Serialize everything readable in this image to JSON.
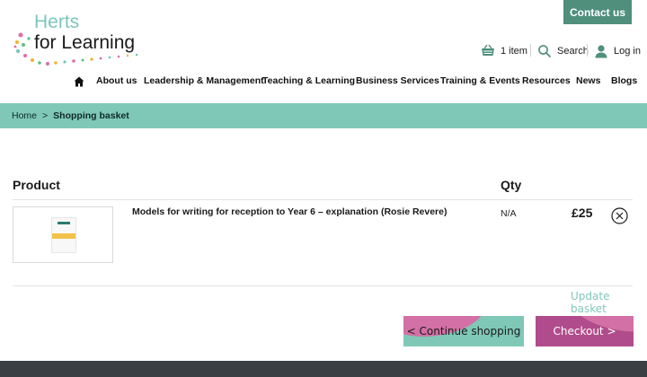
{
  "header": {
    "contact_label": "Contact us",
    "logo_line1": "Herts",
    "logo_line2": "for Learning",
    "basket_label": "1 item",
    "search_label": "Search",
    "login_label": "Log in"
  },
  "nav": {
    "items": [
      "About us",
      "Leadership & Management",
      "Teaching & Learning",
      "Business Services",
      "Training & Events",
      "Resources",
      "News",
      "Blogs"
    ]
  },
  "breadcrumb": {
    "home": "Home",
    "separator": ">",
    "current": "Shopping basket"
  },
  "basket": {
    "col_product": "Product",
    "col_qty": "Qty",
    "items": [
      {
        "title": "Models for writing for reception to Year 6 – explanation (Rosie Revere)",
        "qty": "N/A",
        "price": "£25"
      }
    ],
    "update_label": "Update basket",
    "continue_label": "< Continue shopping",
    "checkout_label": "Checkout >"
  },
  "colors": {
    "teal": "#7fc8b7",
    "dark_teal": "#4f8f7c",
    "pink": "#d370a5",
    "magenta": "#b14c8c",
    "footer": "#3a3f44"
  },
  "icons": {
    "basket": "basket-icon",
    "search": "search-icon",
    "login": "user-icon",
    "home": "home-icon",
    "remove": "close-circle-icon"
  }
}
